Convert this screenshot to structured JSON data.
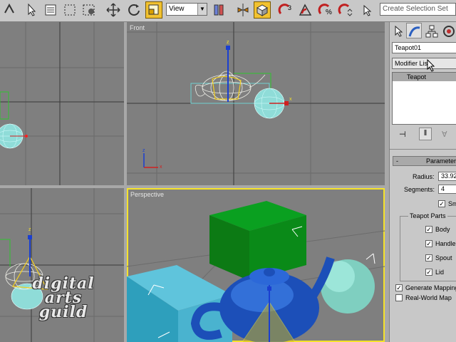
{
  "toolbar": {
    "view_dropdown": "View",
    "selection_set_placeholder": "Create Selection Set",
    "icons": [
      "undo-arrows-icon",
      "select-arrow-icon",
      "select-by-name-icon",
      "rectangle-selection-icon",
      "window-crossing-icon",
      "move-icon",
      "rotate-icon",
      "scale-icon",
      "pivot-icon",
      "mirror-icon",
      "align-icon",
      "snap-3d-icon",
      "angle-snap-icon",
      "percent-snap-icon",
      "spinner-snap-icon"
    ],
    "snap_label": "3",
    "accent_color": "#f2c230"
  },
  "viewports": {
    "top_right_label": "Front",
    "perspective_label": "Perspective",
    "active_color": "#f5e22a",
    "background_color": "#7f7f7f"
  },
  "watermark": {
    "line1": "digital",
    "line2": "arts",
    "line3": "guild"
  },
  "command_panel": {
    "tabs": [
      "create-tab",
      "modify-tab",
      "hierarchy-tab",
      "motion-tab"
    ],
    "object_name": "Teapot01",
    "modifier_list": "Modifier List",
    "stack_item": "Teapot",
    "parameters_title": "Parameters",
    "radius_label": "Radius:",
    "radius_value": "33.92",
    "segments_label": "Segments:",
    "segments_value": "4",
    "smooth_label": "Sm",
    "teapot_parts_label": "Teapot Parts",
    "parts": [
      "Body",
      "Handle",
      "Spout",
      "Lid"
    ],
    "generate_mapping_label": "Generate Mapping",
    "real_world_label": "Real-World Map"
  }
}
